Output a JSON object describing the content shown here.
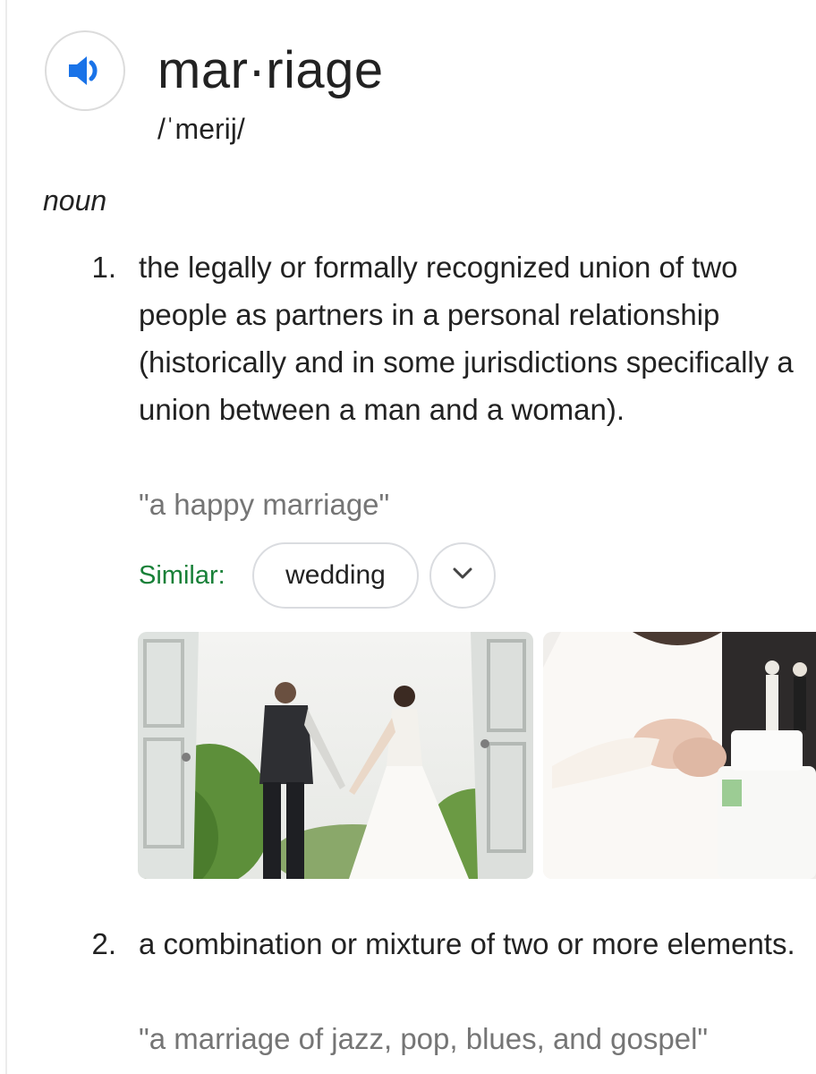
{
  "entry": {
    "headword": "mar·riage",
    "pronunciation": "/ˈmerij/",
    "part_of_speech": "noun",
    "audio_icon": "speaker-icon"
  },
  "senses": [
    {
      "number": "1.",
      "definition": "the legally or formally recognized union of two people as partners in a personal relationship (historically and in some jurisdictions specifically a union between a man and a woman).",
      "example": "\"a happy marriage\"",
      "similar": {
        "label": "Similar:",
        "chips": [
          "wedding"
        ],
        "expand_icon": "chevron-down-icon"
      }
    },
    {
      "number": "2.",
      "definition": "a combination or mixture of two or more elements.",
      "example": "\"a marriage of jazz, pop, blues, and gospel\""
    }
  ],
  "colors": {
    "accent_blue": "#1a73e8",
    "similar_green": "#188038",
    "example_gray": "#757575",
    "chip_border": "#dadce0"
  }
}
